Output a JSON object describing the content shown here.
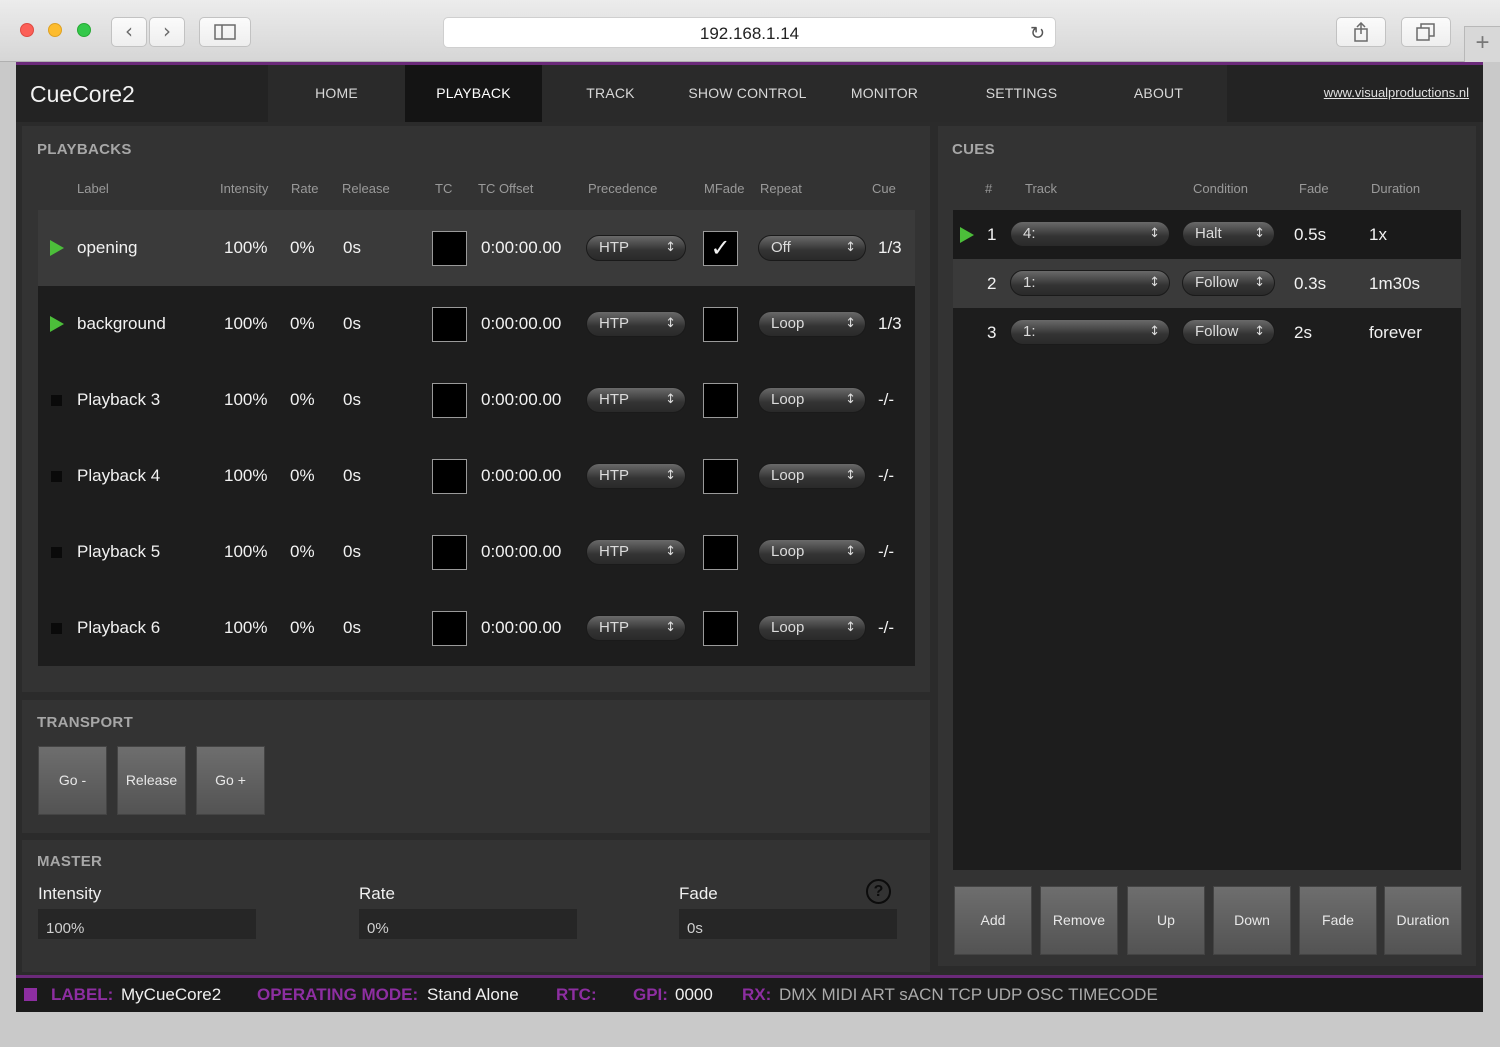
{
  "browser": {
    "url": "192.168.1.14"
  },
  "app": {
    "logo": "CueCore2",
    "nav": [
      "HOME",
      "PLAYBACK",
      "TRACK",
      "SHOW CONTROL",
      "MONITOR",
      "SETTINGS",
      "ABOUT"
    ],
    "active_tab": "PLAYBACK",
    "site_link": "www.visualproductions.nl"
  },
  "playbacks": {
    "title": "PLAYBACKS",
    "columns": {
      "label": "Label",
      "intensity": "Intensity",
      "rate": "Rate",
      "release": "Release",
      "tc": "TC",
      "tc_offset": "TC Offset",
      "precedence": "Precedence",
      "mfade": "MFade",
      "repeat": "Repeat",
      "cue": "Cue"
    },
    "rows": [
      {
        "label": "opening",
        "playing": true,
        "intensity": "100%",
        "rate": "0%",
        "release": "0s",
        "tc_offset": "0:00:00.00",
        "precedence": "HTP",
        "mfade": true,
        "mfade_mark": "✓",
        "repeat": "Off",
        "cue": "1/3"
      },
      {
        "label": "background",
        "playing": true,
        "intensity": "100%",
        "rate": "0%",
        "release": "0s",
        "tc_offset": "0:00:00.00",
        "precedence": "HTP",
        "mfade": false,
        "mfade_mark": "",
        "repeat": "Loop",
        "cue": "1/3"
      },
      {
        "label": "Playback 3",
        "playing": false,
        "intensity": "100%",
        "rate": "0%",
        "release": "0s",
        "tc_offset": "0:00:00.00",
        "precedence": "HTP",
        "mfade": false,
        "mfade_mark": "",
        "repeat": "Loop",
        "cue": "-/-"
      },
      {
        "label": "Playback 4",
        "playing": false,
        "intensity": "100%",
        "rate": "0%",
        "release": "0s",
        "tc_offset": "0:00:00.00",
        "precedence": "HTP",
        "mfade": false,
        "mfade_mark": "",
        "repeat": "Loop",
        "cue": "-/-"
      },
      {
        "label": "Playback 5",
        "playing": false,
        "intensity": "100%",
        "rate": "0%",
        "release": "0s",
        "tc_offset": "0:00:00.00",
        "precedence": "HTP",
        "mfade": false,
        "mfade_mark": "",
        "repeat": "Loop",
        "cue": "-/-"
      },
      {
        "label": "Playback 6",
        "playing": false,
        "intensity": "100%",
        "rate": "0%",
        "release": "0s",
        "tc_offset": "0:00:00.00",
        "precedence": "HTP",
        "mfade": false,
        "mfade_mark": "",
        "repeat": "Loop",
        "cue": "-/-"
      }
    ]
  },
  "transport": {
    "title": "TRANSPORT",
    "go_minus": "Go -",
    "release": "Release",
    "go_plus": "Go +"
  },
  "master": {
    "title": "MASTER",
    "intensity_label": "Intensity",
    "intensity_value": "100%",
    "rate_label": "Rate",
    "rate_value": "0%",
    "fade_label": "Fade",
    "fade_value": "0s",
    "help": "?"
  },
  "cues": {
    "title": "CUES",
    "columns": {
      "num": "#",
      "track": "Track",
      "condition": "Condition",
      "fade": "Fade",
      "duration": "Duration"
    },
    "rows": [
      {
        "num": "1",
        "playing": true,
        "track": "4:",
        "condition": "Halt",
        "fade": "0.5s",
        "duration": "1x"
      },
      {
        "num": "2",
        "playing": false,
        "track": "1:",
        "condition": "Follow",
        "fade": "0.3s",
        "duration": "1m30s"
      },
      {
        "num": "3",
        "playing": false,
        "track": "1:",
        "condition": "Follow",
        "fade": "2s",
        "duration": "forever"
      }
    ],
    "buttons": [
      "Add",
      "Remove",
      "Up",
      "Down",
      "Fade",
      "Duration"
    ]
  },
  "status": {
    "label_key": "LABEL:",
    "label_value": "MyCueCore2",
    "mode_key": "OPERATING MODE:",
    "mode_value": "Stand Alone",
    "rtc_key": "RTC:",
    "rtc_value": "",
    "gpi_key": "GPI:",
    "gpi_value": "0000",
    "rx_key": "RX:",
    "rx_value": "DMX MIDI ART sACN TCP UDP OSC TIMECODE"
  },
  "colors": {
    "accent_purple": "#8d2ea1",
    "play_green": "#4cbe3a"
  }
}
